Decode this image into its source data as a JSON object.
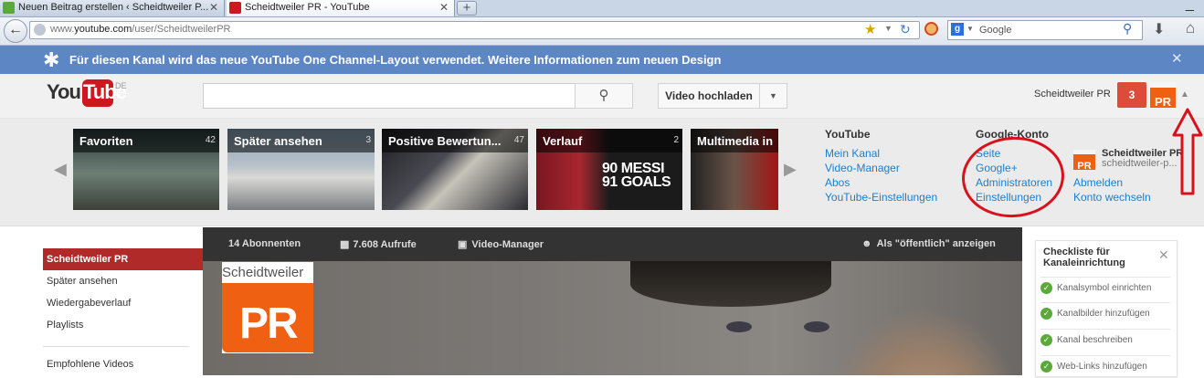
{
  "browser": {
    "tabs": [
      {
        "label": "Neuen Beitrag erstellen ‹ Scheidtweiler P..."
      },
      {
        "label": "Scheidtweiler PR - YouTube"
      }
    ],
    "new_tab": "+",
    "tab_close": "✕",
    "url_prefix": "www.",
    "url_domain": "youtube.com",
    "url_path": "/user/ScheidtweilerPR",
    "search_engine": "Google",
    "search_placeholder": "Google"
  },
  "banner": {
    "text": "Für diesen Kanal wird das neue YouTube One Channel-Layout verwendet. Weitere Informationen zum neuen Design",
    "close": "✕"
  },
  "header": {
    "logo_you": "You",
    "logo_tube": "Tube",
    "logo_region": "DE",
    "upload_label": "Video hochladen",
    "username": "Scheidtweiler PR",
    "notification_count": "3",
    "avatar_text": "PR"
  },
  "guide": {
    "thumbnails": [
      {
        "label": "Favoriten",
        "count": "42"
      },
      {
        "label": "Später ansehen",
        "count": "3"
      },
      {
        "label": "Positive Bewertun...",
        "count": "47"
      },
      {
        "label": "Verlauf",
        "count": "2"
      },
      {
        "label": "Multimedia in",
        "count": ""
      }
    ],
    "thumb_overlay_text": "90 MESSI 91 GOALS",
    "youtube_heading": "YouTube",
    "youtube_links": [
      "Mein Kanal",
      "Video-Manager",
      "Abos",
      "YouTube-Einstellungen"
    ],
    "google_heading": "Google-Konto",
    "google_links": [
      "Seite",
      "Google+",
      "Administratoren",
      "Einstellungen"
    ],
    "profile_name": "Scheidtweiler PR",
    "profile_id": "scheidtweiler-p...",
    "profile_links": [
      "Abmelden",
      "Konto wechseln"
    ]
  },
  "sidebar": {
    "items": [
      {
        "label": "Scheidtweiler PR",
        "active": true
      },
      {
        "label": "Später ansehen"
      },
      {
        "label": "Wiedergabeverlauf"
      },
      {
        "label": "Playlists"
      },
      {
        "label": "Empfohlene Videos"
      }
    ]
  },
  "channel_bar": {
    "subscribers": "14 Abonnenten",
    "views": "7.608 Aufrufe",
    "video_manager": "Video-Manager",
    "view_as": "Als \"öffentlich\" anzeigen"
  },
  "channel_icon": {
    "name": "Scheidtweiler",
    "pr": "PR"
  },
  "checklist": {
    "title": "Checkliste für Kanaleinrichtung",
    "close": "✕",
    "items": [
      {
        "label": "Kanalsymbol einrichten"
      },
      {
        "label": "Kanalbilder hinzufügen"
      },
      {
        "label": "Kanal beschreiben"
      },
      {
        "label": "Web-Links hinzufügen"
      }
    ]
  },
  "colors": {
    "banner": "#5d87c4",
    "youtube_red": "#cc181e",
    "brand_orange": "#f06012",
    "link_blue": "#1b7fcc",
    "annotation_red": "#d8121c"
  }
}
